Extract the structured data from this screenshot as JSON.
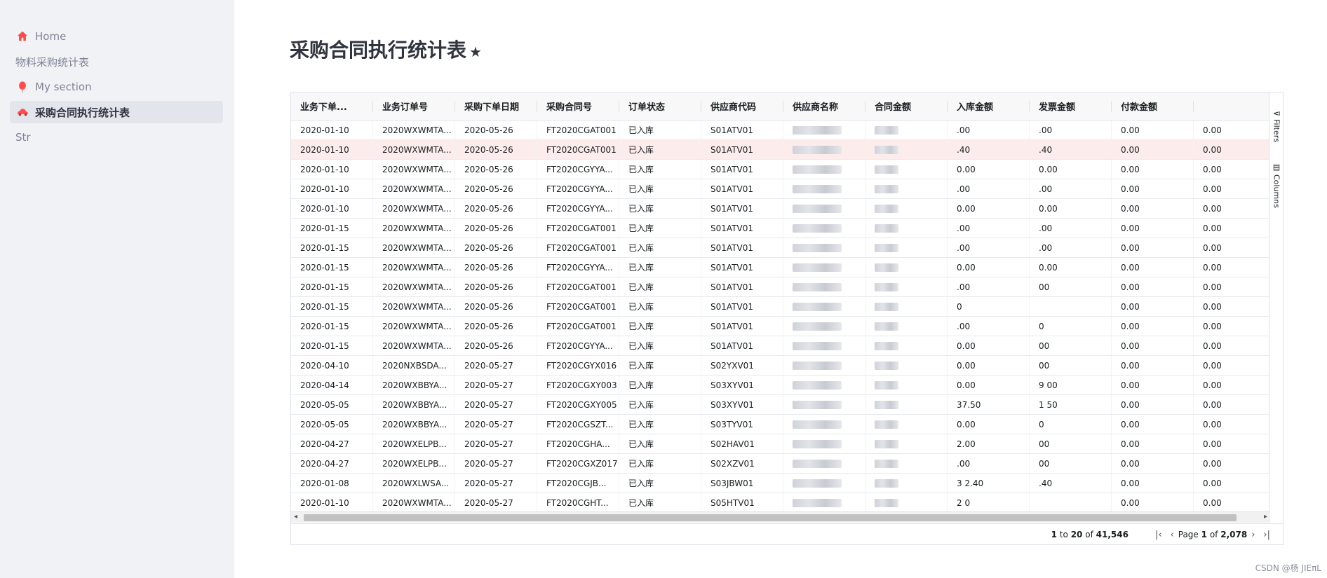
{
  "sidebar": {
    "items": [
      {
        "label": "Home",
        "icon": "home-icon"
      },
      {
        "label": "物料采购统计表",
        "icon": ""
      },
      {
        "label": "My section",
        "icon": "balloon-icon"
      },
      {
        "label": "采购合同执行统计表",
        "icon": "car-icon",
        "active": true
      },
      {
        "label": "Str",
        "icon": ""
      }
    ]
  },
  "page": {
    "title": "采购合同执行统计表",
    "star": "★"
  },
  "table": {
    "columns": [
      "业务下单...",
      "业务订单号",
      "采购下单日期",
      "采购合同号",
      "订单状态",
      "供应商代码",
      "供应商名称",
      "合同金额",
      "入库金额",
      "发票金额",
      "付款金额",
      ""
    ],
    "rows": [
      [
        "2020-01-10",
        "2020WXWMTA...",
        "2020-05-26",
        "FT2020CGAT001",
        "已入库",
        "S01ATV01",
        "",
        "",
        ".00",
        ".00",
        "0.00",
        "0.00"
      ],
      [
        "2020-01-10",
        "2020WXWMTA...",
        "2020-05-26",
        "FT2020CGAT001",
        "已入库",
        "S01ATV01",
        "",
        "",
        ".40",
        ".40",
        "0.00",
        "0.00"
      ],
      [
        "2020-01-10",
        "2020WXWMTA...",
        "2020-05-26",
        "FT2020CGYYA...",
        "已入库",
        "S01ATV01",
        "",
        "",
        "0.00",
        "0.00",
        "0.00",
        "0.00"
      ],
      [
        "2020-01-10",
        "2020WXWMTA...",
        "2020-05-26",
        "FT2020CGYYA...",
        "已入库",
        "S01ATV01",
        "",
        "",
        ".00",
        ".00",
        "0.00",
        "0.00"
      ],
      [
        "2020-01-10",
        "2020WXWMTA...",
        "2020-05-26",
        "FT2020CGYYA...",
        "已入库",
        "S01ATV01",
        "",
        "",
        "0.00",
        "0.00",
        "0.00",
        "0.00"
      ],
      [
        "2020-01-15",
        "2020WXWMTA...",
        "2020-05-26",
        "FT2020CGAT001",
        "已入库",
        "S01ATV01",
        "",
        "",
        ".00",
        ".00",
        "0.00",
        "0.00"
      ],
      [
        "2020-01-15",
        "2020WXWMTA...",
        "2020-05-26",
        "FT2020CGAT001",
        "已入库",
        "S01ATV01",
        "",
        "",
        ".00",
        ".00",
        "0.00",
        "0.00"
      ],
      [
        "2020-01-15",
        "2020WXWMTA...",
        "2020-05-26",
        "FT2020CGYYA...",
        "已入库",
        "S01ATV01",
        "",
        "",
        "0.00",
        "0.00",
        "0.00",
        "0.00"
      ],
      [
        "2020-01-15",
        "2020WXWMTA...",
        "2020-05-26",
        "FT2020CGAT001",
        "已入库",
        "S01ATV01",
        "",
        "",
        ".00",
        "00",
        "0.00",
        "0.00"
      ],
      [
        "2020-01-15",
        "2020WXWMTA...",
        "2020-05-26",
        "FT2020CGAT001",
        "已入库",
        "S01ATV01",
        "",
        "",
        "0",
        "",
        "0.00",
        "0.00"
      ],
      [
        "2020-01-15",
        "2020WXWMTA...",
        "2020-05-26",
        "FT2020CGAT001",
        "已入库",
        "S01ATV01",
        "",
        "",
        ".00",
        "0",
        "0.00",
        "0.00"
      ],
      [
        "2020-01-15",
        "2020WXWMTA...",
        "2020-05-26",
        "FT2020CGYYA...",
        "已入库",
        "S01ATV01",
        "",
        "",
        "0.00",
        "00",
        "0.00",
        "0.00"
      ],
      [
        "2020-04-10",
        "2020NXBSDA...",
        "2020-05-27",
        "FT2020CGYX016",
        "已入库",
        "S02YXV01",
        "",
        "",
        "0.00",
        "00",
        "0.00",
        "0.00"
      ],
      [
        "2020-04-14",
        "2020WXBBYA...",
        "2020-05-27",
        "FT2020CGXY003",
        "已入库",
        "S03XYV01",
        "",
        "",
        "0.00",
        "9 00",
        "0.00",
        "0.00"
      ],
      [
        "2020-05-05",
        "2020WXBBYA...",
        "2020-05-27",
        "FT2020CGXY005",
        "已入库",
        "S03XYV01",
        "",
        "",
        "37.50",
        "1 50",
        "0.00",
        "0.00"
      ],
      [
        "2020-05-05",
        "2020WXBBYA...",
        "2020-05-27",
        "FT2020CGSZT...",
        "已入库",
        "S03TYV01",
        "",
        "",
        "0.00",
        "0",
        "0.00",
        "0.00"
      ],
      [
        "2020-04-27",
        "2020WXELPB...",
        "2020-05-27",
        "FT2020CGHA...",
        "已入库",
        "S02HAV01",
        "",
        "",
        "2.00",
        "00",
        "0.00",
        "0.00"
      ],
      [
        "2020-04-27",
        "2020WXELPB...",
        "2020-05-27",
        "FT2020CGXZ017",
        "已入库",
        "S02XZV01",
        "",
        "",
        ".00",
        "00",
        "0.00",
        "0.00"
      ],
      [
        "2020-01-08",
        "2020WXLWSA...",
        "2020-05-27",
        "FT2020CGJB...",
        "已入库",
        "S03JBW01",
        "",
        "",
        "3 2.40",
        ".40",
        "0.00",
        "0.00"
      ],
      [
        "2020-01-10",
        "2020WXWMTA...",
        "2020-05-27",
        "FT2020CGHT...",
        "已入库",
        "S05HTV01",
        "",
        "",
        "2 0",
        "",
        "0.00",
        "0.00"
      ]
    ],
    "selected_row": 1
  },
  "side_panel": {
    "filters": "Filters",
    "columns": "Columns"
  },
  "pager": {
    "from": "1",
    "to": "20",
    "total": "41,546",
    "to_word": "to",
    "of_word": "of",
    "page_word": "Page",
    "page": "1",
    "page_of": "of",
    "page_total": "2,078"
  },
  "watermark": "CSDN @杨 JIEπL",
  "colors": {
    "accent": "#ff4b4b",
    "selected_row": "#fdecec",
    "sidebar_bg": "#f0f2f6"
  }
}
